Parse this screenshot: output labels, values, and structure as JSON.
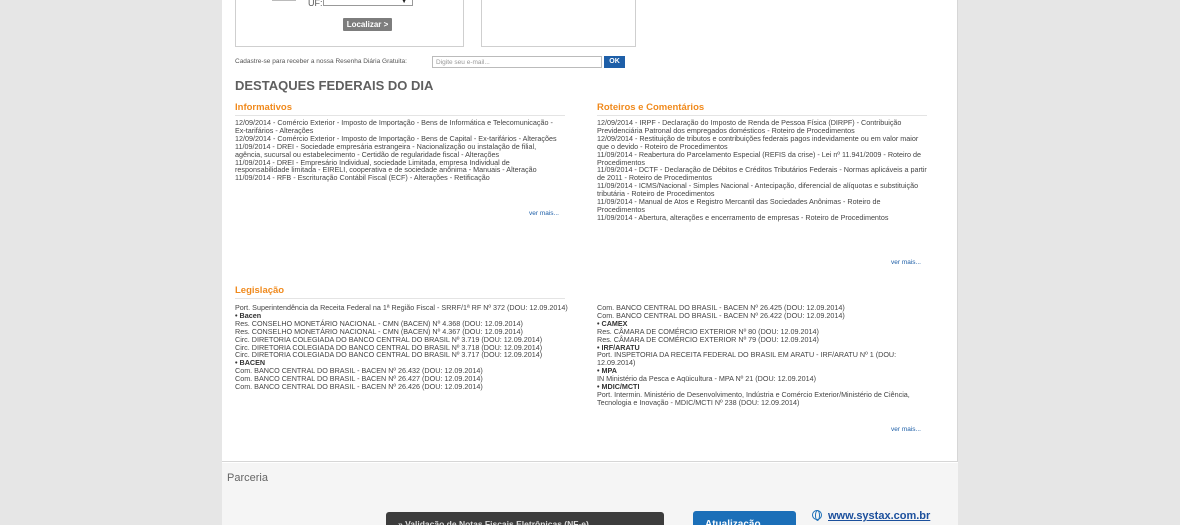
{
  "form": {
    "uf_label": "UF:",
    "uf_selected": "",
    "localizar_label": "Localizar >"
  },
  "newsletter": {
    "label": "Cadastre-se para receber a nossa Resenha Diária Gratuita:",
    "placeholder": "Digite seu e-mail...",
    "ok_label": "OK"
  },
  "section_title": "DESTAQUES FEDERAIS DO DIA",
  "informativos": {
    "title": "Informativos",
    "items": [
      "12/09/2014 - Comércio Exterior - Imposto de Importação - Bens de Informática e Telecomunicação - Ex-tarifários - Alterações",
      "12/09/2014 - Comércio Exterior - Imposto de Importação - Bens de Capital - Ex-tarifários - Alterações",
      "11/09/2014 - DREI - Sociedade empresária estrangeira - Nacionalização ou instalação de filial, agência, sucursal ou estabelecimento - Certidão de regularidade fiscal - Alterações",
      "11/09/2014 - DREI - Empresário Individual, sociedade Limitada, empresa Individual de responsabilidade limitada - EIRELI, cooperativa e de sociedade anônima - Manuais - Alteração",
      "11/09/2014 - RFB - Escrituração Contábil Fiscal (ECF) - Alterações - Retificação"
    ],
    "more": "ver mais..."
  },
  "roteiros": {
    "title": "Roteiros e Comentários",
    "items": [
      "12/09/2014 - IRPF - Declaração do Imposto de Renda de Pessoa Física (DIRPF) - Contribuição Previdenciária Patronal dos empregados domésticos - Roteiro de Procedimentos",
      "12/09/2014 - Restituição de tributos e contribuições federais pagos indevidamente ou em valor maior que o devido - Roteiro de Procedimentos",
      "11/09/2014 - Reabertura do Parcelamento Especial (REFIS da crise) - Lei nº 11.941/2009 - Roteiro de Procedimentos",
      "11/09/2014 - DCTF - Declaração de Débitos e Créditos Tributários Federais - Normas aplicáveis a partir de 2011 - Roteiro de Procedimentos",
      "11/09/2014 - ICMS/Nacional - Simples Nacional - Antecipação, diferencial de alíquotas e substituição tributária - Roteiro de Procedimentos",
      "11/09/2014 - Manual de Atos e Registro Mercantil das Sociedades Anônimas - Roteiro de Procedimentos",
      "11/09/2014 - Abertura, alterações e encerramento de empresas - Roteiro de Procedimentos"
    ],
    "more": "ver mais..."
  },
  "legislacao": {
    "title": "Legislação",
    "left": [
      {
        "type": "item",
        "text": "Port. Superintendência da Receita Federal na 1ª Região Fiscal - SRRF/1ª RF Nº 372 (DOU: 12.09.2014)"
      },
      {
        "type": "cat",
        "text": "• Bacen"
      },
      {
        "type": "item",
        "text": "Res. CONSELHO MONETÁRIO NACIONAL - CMN (BACEN) Nº 4.368 (DOU: 12.09.2014)"
      },
      {
        "type": "item",
        "text": "Res. CONSELHO MONETÁRIO NACIONAL - CMN (BACEN) Nº 4.367 (DOU: 12.09.2014)"
      },
      {
        "type": "item",
        "text": "Circ. DIRETORIA COLEGIADA DO BANCO CENTRAL DO BRASIL Nº 3.719 (DOU: 12.09.2014)"
      },
      {
        "type": "item",
        "text": "Circ. DIRETORIA COLEGIADA DO BANCO CENTRAL DO BRASIL Nº 3.718 (DOU: 12.09.2014)"
      },
      {
        "type": "item",
        "text": "Circ. DIRETORIA COLEGIADA DO BANCO CENTRAL DO BRASIL Nº 3.717 (DOU: 12.09.2014)"
      },
      {
        "type": "cat",
        "text": "• BACEN"
      },
      {
        "type": "item",
        "text": "Com. BANCO CENTRAL DO BRASIL - BACEN Nº 26.432 (DOU: 12.09.2014)"
      },
      {
        "type": "item",
        "text": "Com. BANCO CENTRAL DO BRASIL - BACEN Nº 26.427 (DOU: 12.09.2014)"
      },
      {
        "type": "item",
        "text": "Com. BANCO CENTRAL DO BRASIL - BACEN Nº 26.426 (DOU: 12.09.2014)"
      }
    ],
    "right": [
      {
        "type": "item",
        "text": "Com. BANCO CENTRAL DO BRASIL - BACEN Nº 26.425 (DOU: 12.09.2014)"
      },
      {
        "type": "item",
        "text": "Com. BANCO CENTRAL DO BRASIL - BACEN Nº 26.422 (DOU: 12.09.2014)"
      },
      {
        "type": "cat",
        "text": "• CAMEX"
      },
      {
        "type": "item",
        "text": "Res. CÂMARA DE COMÉRCIO EXTERIOR Nº 80 (DOU: 12.09.2014)"
      },
      {
        "type": "item",
        "text": "Res. CÂMARA DE COMÉRCIO EXTERIOR Nº 79 (DOU: 12.09.2014)"
      },
      {
        "type": "cat",
        "text": "• IRF/ARATU"
      },
      {
        "type": "item",
        "text": "Port. INSPETORIA DA RECEITA FEDERAL DO BRASIL EM ARATU - IRF/ARATU Nº 1 (DOU: 12.09.2014)"
      },
      {
        "type": "cat",
        "text": "• MPA"
      },
      {
        "type": "item",
        "text": "IN Ministério da Pesca e Aqüicultura - MPA Nº 21 (DOU: 12.09.2014)"
      },
      {
        "type": "cat",
        "text": "• MDIC/MCTI"
      },
      {
        "type": "item",
        "text": "Port. Intermin. Ministério de Desenvolvimento, Indústria e Comércio Exterior/Ministério de Ciência, Tecnologia e Inovação - MDIC/MCTI Nº 238 (DOU: 12.09.2014)"
      }
    ],
    "more": "ver mais..."
  },
  "footer": {
    "parceria": "Parceria",
    "banner_dark": "» Validação de Notas Fiscais Eletrônicas (NF-e)",
    "banner_blue": "Atualização",
    "site_link": "www.systax.com.br"
  }
}
